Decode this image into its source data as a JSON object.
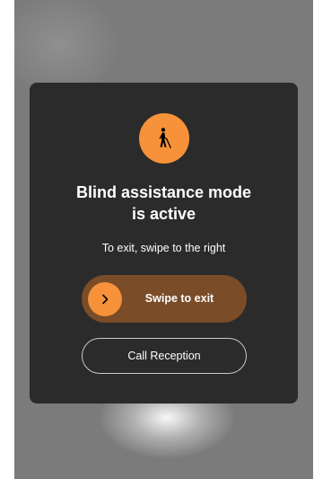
{
  "dialog": {
    "icon": "blind-person-with-cane-icon",
    "title_line1": "Blind assistance mode",
    "title_line2": "is active",
    "subtitle": "To exit, swipe to the right",
    "swipe": {
      "label": "Swipe to exit",
      "knob_icon": "chevron-right-icon"
    },
    "call_button_label": "Call Reception"
  },
  "colors": {
    "accent": "#f7923a",
    "swipe_track": "#7a4c28",
    "dialog_bg": "#2b2b2b",
    "backdrop": "#7b7b7b"
  }
}
